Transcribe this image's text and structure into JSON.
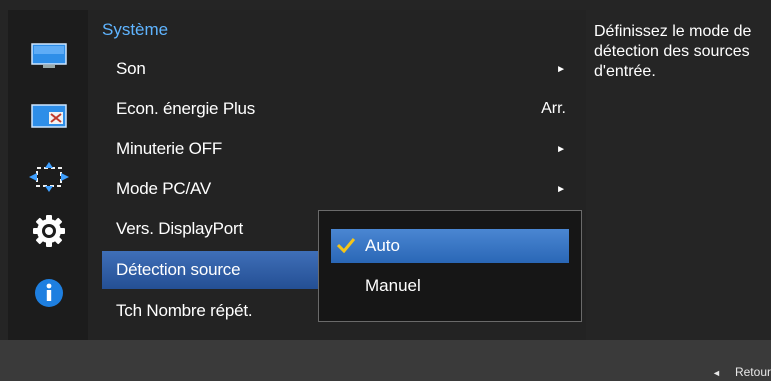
{
  "sidebar": {
    "icons": [
      {
        "name": "display-icon"
      },
      {
        "name": "picture-in-picture-icon"
      },
      {
        "name": "position-size-icon"
      },
      {
        "name": "settings-icon"
      },
      {
        "name": "info-icon"
      }
    ]
  },
  "menu": {
    "title": "Système",
    "items": [
      {
        "label": "Son",
        "value": "",
        "arrow": "►"
      },
      {
        "label": "Econ. énergie Plus",
        "value": "Arr.",
        "arrow": ""
      },
      {
        "label": "Minuterie OFF",
        "value": "",
        "arrow": "►"
      },
      {
        "label": "Mode PC/AV",
        "value": "",
        "arrow": "►"
      },
      {
        "label": "Vers. DisplayPort",
        "value": "",
        "arrow": ""
      },
      {
        "label": "Détection source",
        "value": "",
        "arrow": "",
        "active": true
      },
      {
        "label": "Tch Nombre répét.",
        "value": "",
        "arrow": ""
      }
    ]
  },
  "submenu": {
    "options": [
      {
        "label": "Auto",
        "selected": true
      },
      {
        "label": "Manuel",
        "selected": false
      }
    ]
  },
  "help": {
    "text": "Définissez le mode de détection des sources d'entrée."
  },
  "footer": {
    "back_arrow": "◄",
    "back_label": "Retour"
  },
  "colors": {
    "accent": "#5fb4ff",
    "highlight": "#2f63b0",
    "check": "#f5c518"
  }
}
